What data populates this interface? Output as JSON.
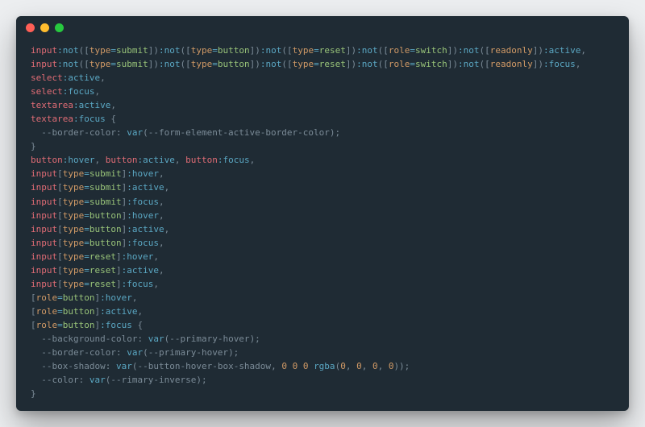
{
  "window": {
    "controls": [
      "close",
      "minimize",
      "zoom"
    ]
  },
  "code": {
    "rule1": {
      "selectors": [
        "input:not([type=submit]):not([type=button]):not([type=reset]):not([role=switch]):not([readonly]):active",
        "input:not([type=submit]):not([type=button]):not([type=reset]):not([role=switch]):not([readonly]):focus",
        "select:active",
        "select:focus",
        "textarea:active",
        "textarea:focus"
      ],
      "declarations": [
        {
          "property": "--border-color",
          "value": "var(--form-element-active-border-color)"
        }
      ]
    },
    "rule2": {
      "selectors": [
        "button:hover",
        "button:active",
        "button:focus",
        "input[type=submit]:hover",
        "input[type=submit]:active",
        "input[type=submit]:focus",
        "input[type=button]:hover",
        "input[type=button]:active",
        "input[type=button]:focus",
        "input[type=reset]:hover",
        "input[type=reset]:active",
        "input[type=reset]:focus",
        "[role=button]:hover",
        "[role=button]:active",
        "[role=button]:focus"
      ],
      "declarations": [
        {
          "property": "--background-color",
          "value": "var(--primary-hover)"
        },
        {
          "property": "--border-color",
          "value": "var(--primary-hover)"
        },
        {
          "property": "--box-shadow",
          "value": "var(--button-hover-box-shadow, 0 0 0 rgba(0, 0, 0, 0))"
        },
        {
          "property": "--color",
          "value": "var(--rimary-inverse)"
        }
      ]
    }
  },
  "tokens": {
    "tags": {
      "input": "input",
      "select": "select",
      "textarea": "textarea",
      "button": "button"
    },
    "pseudo": {
      "not": ":not",
      "active": ":active",
      "focus": ":focus",
      "hover": ":hover"
    },
    "attrs": {
      "type": "type",
      "role": "role",
      "readonly": "readonly"
    },
    "values": {
      "submit": "submit",
      "button": "button",
      "reset": "reset",
      "switch": "switch"
    },
    "fns": {
      "var": "var",
      "rgba": "rgba"
    },
    "vars": {
      "form_active": "--form-element-active-border-color",
      "primary_hover": "--primary-hover",
      "btn_hover_bs": "--button-hover-box-shadow",
      "rimary_inverse": "--rimary-inverse",
      "border_color": "--border-color",
      "background_color": "--background-color",
      "box_shadow": "--box-shadow",
      "color": "--color"
    },
    "nums": {
      "zero": "0"
    }
  }
}
